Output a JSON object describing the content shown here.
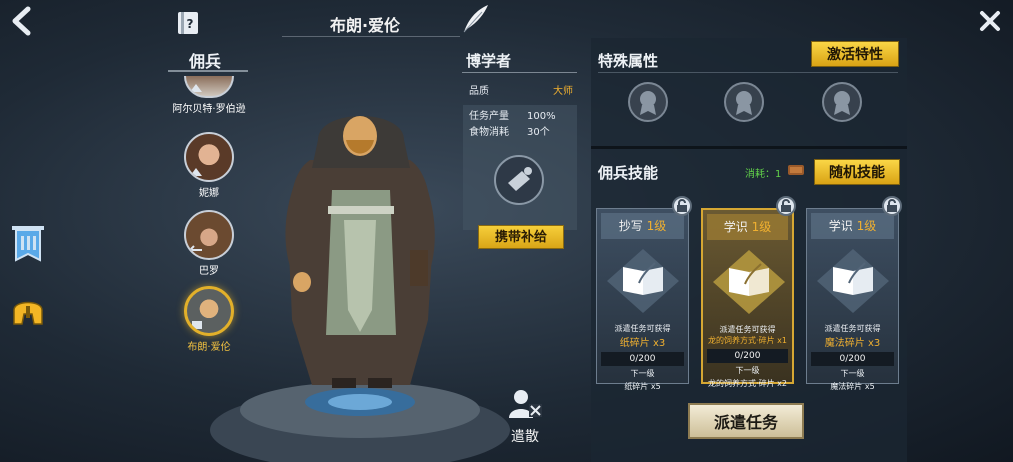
{
  "hero_name": "布朗·爱伦",
  "mercenary_list": {
    "title": "佣兵",
    "items": [
      {
        "name": "阿尔贝特·罗伯逊",
        "selected": false
      },
      {
        "name": "妮娜",
        "selected": false
      },
      {
        "name": "巴罗",
        "selected": false
      },
      {
        "name": "布朗·爱伦",
        "selected": true
      }
    ]
  },
  "class_info": {
    "class_name": "博学者",
    "quality_label": "品质",
    "quality_value": "大师",
    "stats": [
      {
        "label": "任务产量",
        "value": "100%"
      },
      {
        "label": "食物消耗",
        "value": "30个"
      }
    ],
    "carry_supply_button": "携带补给"
  },
  "dismiss_label": "遣散",
  "special_attributes": {
    "title": "特殊属性",
    "activate_button": "激活特性",
    "slot_count": 3
  },
  "skills": {
    "title": "佣兵技能",
    "cost_label": "消耗：1",
    "random_button": "随机技能",
    "cards": [
      {
        "name": "抄写",
        "level": "1级",
        "desc": "派遣任务可获得",
        "reward": "纸碎片 x3",
        "progress": "0/200",
        "next_label": "下一级",
        "next_reward": "纸碎片 x5",
        "highlight": false
      },
      {
        "name": "学识",
        "level": "1级",
        "desc": "派遣任务可获得",
        "reward": "龙的饲养方式·碎片 x1",
        "progress": "0/200",
        "next_label": "下一级",
        "next_reward": "龙的饲养方式·碎片 x2",
        "highlight": true
      },
      {
        "name": "学识",
        "level": "1级",
        "desc": "派遣任务可获得",
        "reward": "魔法碎片 x3",
        "progress": "0/200",
        "next_label": "下一级",
        "next_reward": "魔法碎片 x5",
        "highlight": false
      }
    ]
  },
  "dispatch_button": "派遣任务",
  "colors": {
    "accent_gold": "#f0b030",
    "cost_green": "#62d14a",
    "panel_bg": "#1b2632"
  }
}
